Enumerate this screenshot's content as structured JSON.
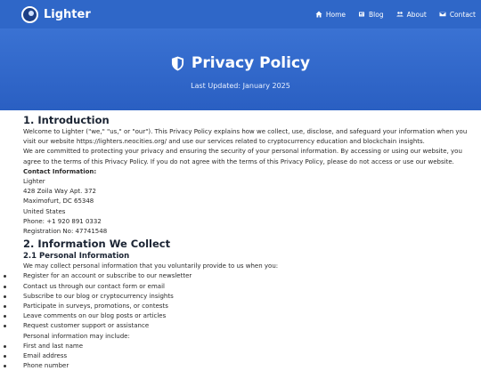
{
  "brand": {
    "name": "Lighter"
  },
  "nav": [
    {
      "label": "Home",
      "icon": "home-icon"
    },
    {
      "label": "Blog",
      "icon": "newspaper-icon"
    },
    {
      "label": "About",
      "icon": "users-icon"
    },
    {
      "label": "Contact",
      "icon": "envelope-icon"
    }
  ],
  "hero": {
    "title": "Privacy Policy",
    "icon": "shield-icon",
    "updated": "Last Updated: January 2025"
  },
  "section1": {
    "heading": "1. Introduction",
    "para1": "Welcome to Lighter (\"we,\" \"us,\" or \"our\"). This Privacy Policy explains how we collect, use, disclose, and safeguard your information when you visit our website https://lighters.neocities.org/ and use our services related to cryptocurrency education and blockchain insights.",
    "para2": "We are committed to protecting your privacy and ensuring the security of your personal information. By accessing or using our website, you agree to the terms of this Privacy Policy. If you do not agree with the terms of this Privacy Policy, please do not access or use our website.",
    "contact_heading": "Contact Information:",
    "contact_lines": [
      "Lighter",
      "428 Zoila Way Apt. 372",
      "Maximofurt, DC 65348",
      "United States",
      "Phone: +1 920 891 0332",
      "Registration No: 47741548"
    ]
  },
  "section2": {
    "heading": "2. Information We Collect",
    "sub_heading": "2.1 Personal Information",
    "intro": "We may collect personal information that you voluntarily provide to us when you:",
    "items": [
      "Register for an account or subscribe to our newsletter",
      "Contact us through our contact form or email",
      "Subscribe to our blog or cryptocurrency insights",
      "Participate in surveys, promotions, or contests",
      "Leave comments on our blog posts or articles",
      "Request customer support or assistance"
    ],
    "may_include": "Personal information may include:",
    "info_items": [
      "First and last name",
      "Email address",
      "Phone number"
    ]
  },
  "colors": {
    "nav_bg": "#2f67c8",
    "hero_bg": "#2a5fc2",
    "heading": "#1b2433"
  }
}
